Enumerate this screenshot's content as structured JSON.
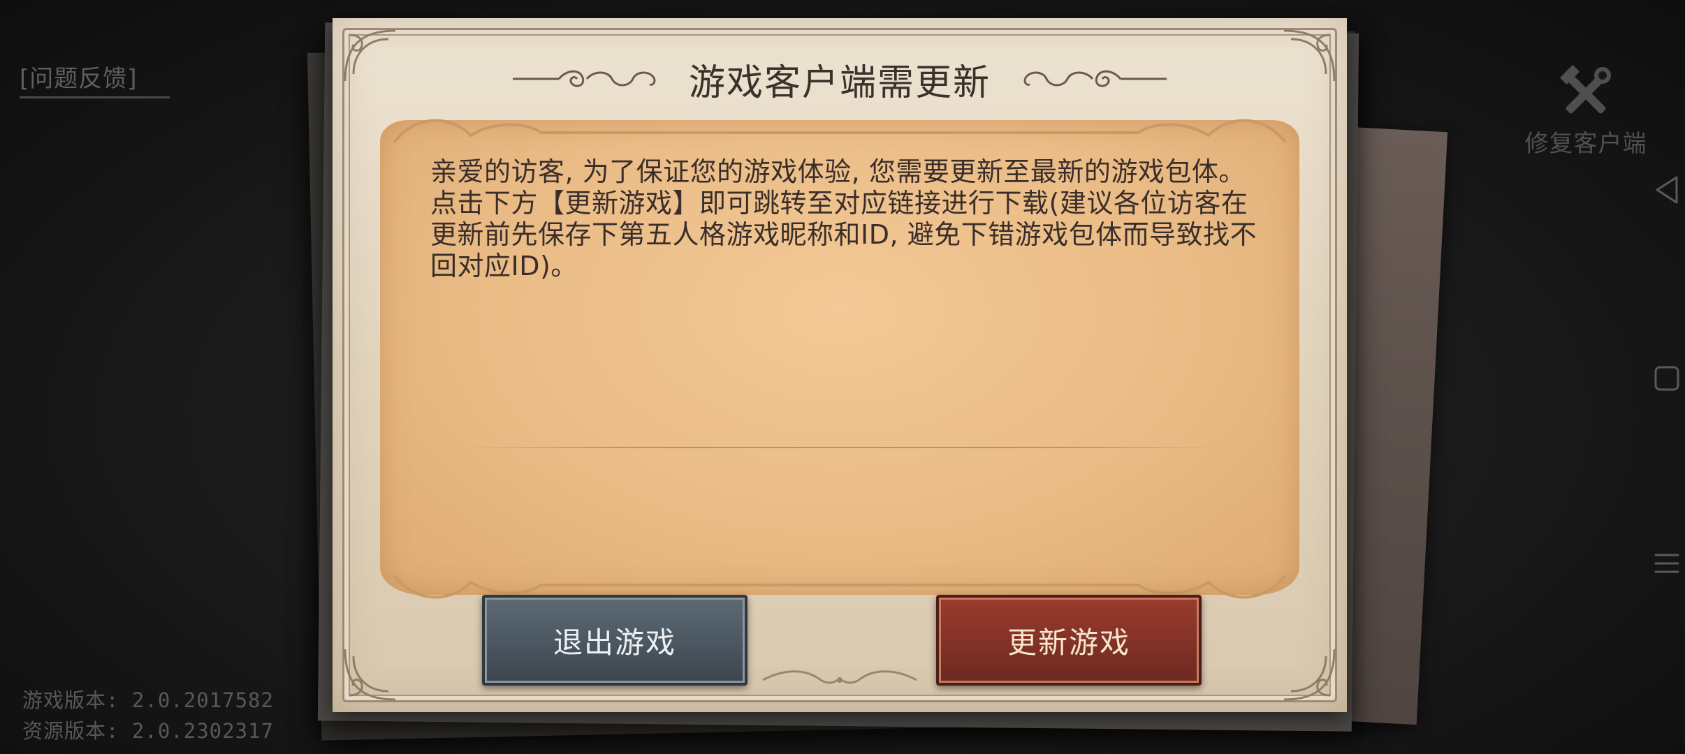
{
  "background": {
    "feedback_link": "[问题反馈]",
    "repair_client": {
      "label": "修复客户端",
      "icon": "wrench-hammer-icon"
    },
    "versions": {
      "game": "游戏版本: 2.0.2017582",
      "resource": "资源版本: 2.0.2302317"
    }
  },
  "system_nav": {
    "icons": [
      "back-triangle-icon",
      "home-square-icon",
      "menu-lines-icon"
    ]
  },
  "dialog": {
    "title": "游戏客户端需更新",
    "message": "亲爱的访客, 为了保证您的游戏体验, 您需要更新至最新的游戏包体。点击下方【更新游戏】即可跳转至对应链接进行下载(建议各位访客在更新前先保存下第五人格游戏昵称和ID, 避免下错游戏包体而导致找不回对应ID)。",
    "buttons": {
      "exit": "退出游戏",
      "update": "更新游戏"
    }
  },
  "colors": {
    "exit_button": "#4a5660",
    "update_button": "#823126",
    "panel": "#eabb85",
    "paper": "#e2d4bd"
  }
}
